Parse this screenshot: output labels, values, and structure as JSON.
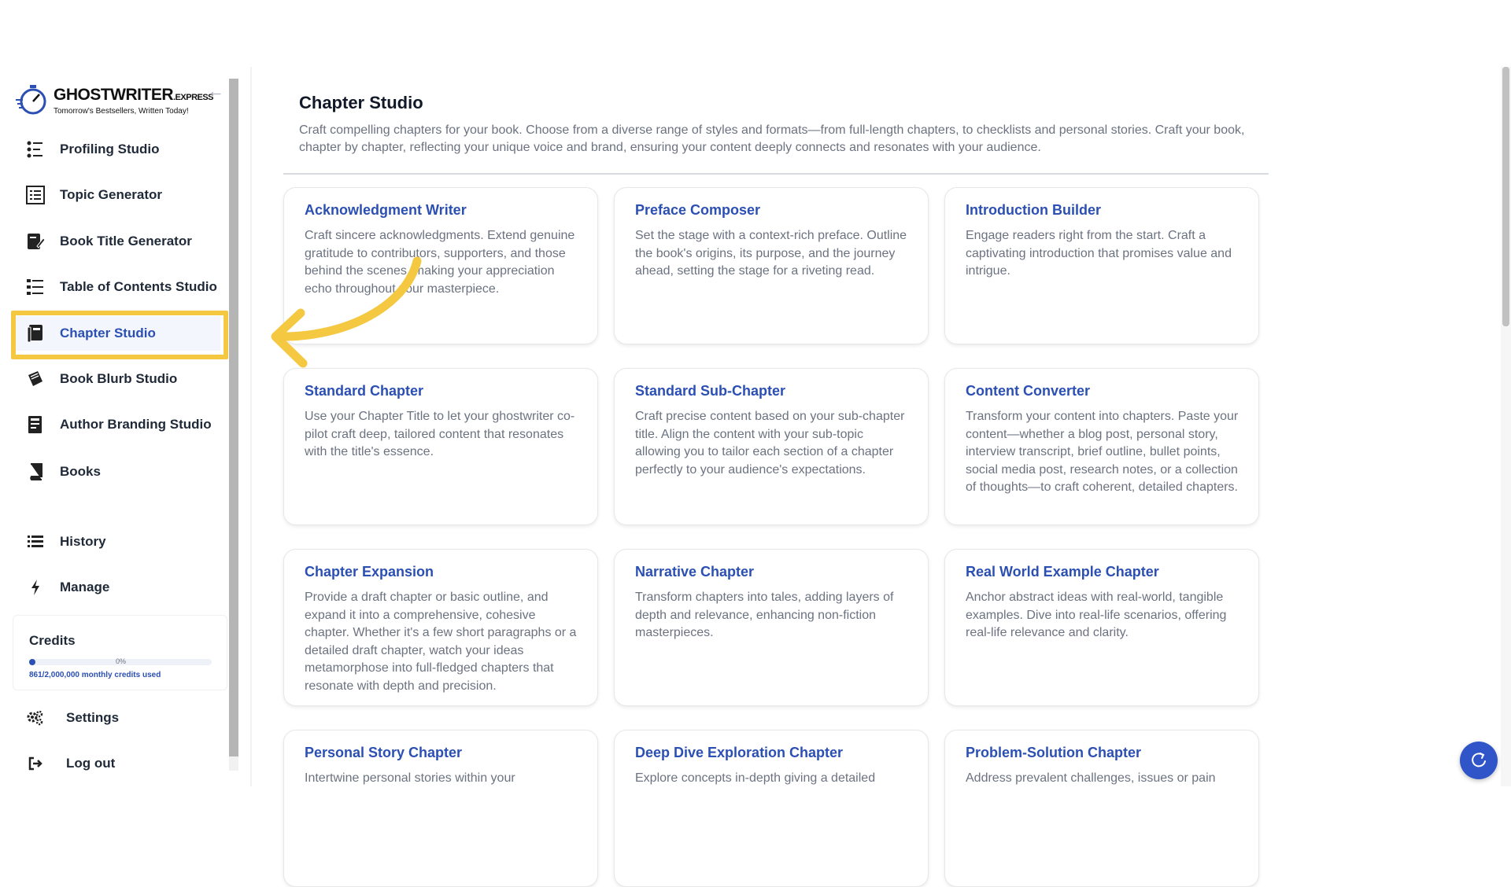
{
  "brand": {
    "name": "GHOSTWRITER",
    "suffix": ".EXPRESS",
    "tagline": "Tomorrow's Bestsellers, Written Today!"
  },
  "sidebar": {
    "items": [
      {
        "label": "Profiling Studio",
        "icon": "profiling-icon"
      },
      {
        "label": "Topic Generator",
        "icon": "topic-icon"
      },
      {
        "label": "Book Title Generator",
        "icon": "book-title-icon"
      },
      {
        "label": "Table of Contents Studio",
        "icon": "toc-icon"
      },
      {
        "label": "Chapter Studio",
        "icon": "chapter-icon",
        "active": true
      },
      {
        "label": "Book Blurb Studio",
        "icon": "blurb-icon"
      },
      {
        "label": "Author Branding Studio",
        "icon": "branding-icon"
      },
      {
        "label": "Books",
        "icon": "books-icon"
      }
    ],
    "secondary": [
      {
        "label": "History",
        "icon": "list-icon"
      },
      {
        "label": "Manage",
        "icon": "bolt-icon"
      }
    ],
    "credits": {
      "title": "Credits",
      "percent_label": "0%",
      "used_label": "861/2,000,000 monthly credits used",
      "fraction": 0.0004
    },
    "footer": [
      {
        "label": "Settings",
        "icon": "gears-icon"
      },
      {
        "label": "Log out",
        "icon": "logout-icon"
      }
    ]
  },
  "page": {
    "title": "Chapter Studio",
    "description": "Craft compelling chapters for your book. Choose from a diverse range of styles and formats—from full-length chapters, to checklists and personal stories. Craft your book, chapter by chapter, reflecting your unique voice and brand, ensuring your content deeply connects and resonates with your audience."
  },
  "cards": [
    {
      "title": "Acknowledgment Writer",
      "desc": "Craft sincere acknowledgments. Extend genuine gratitude to contributors, supporters, and those behind the scenes, making your appreciation echo throughout your masterpiece."
    },
    {
      "title": "Preface Composer",
      "desc": "Set the stage with a context-rich preface. Outline the book's origins, its purpose, and the journey ahead, setting the stage for a riveting read."
    },
    {
      "title": "Introduction Builder",
      "desc": "Engage readers right from the start. Craft a captivating introduction that promises value and intrigue."
    },
    {
      "title": "Standard Chapter",
      "desc": "Use your Chapter Title to let your ghostwriter co-pilot craft deep, tailored content that resonates with the title's essence."
    },
    {
      "title": "Standard Sub-Chapter",
      "desc": "Craft precise content based on your sub-chapter title. Align the content with your sub-topic allowing you to tailor each section of a chapter perfectly to your audience's expectations."
    },
    {
      "title": "Content Converter",
      "desc": "Transform your content into chapters. Paste your content—whether a blog post, personal story, interview transcript, brief outline, bullet points, social media post, research notes, or a collection of thoughts—to craft coherent, detailed chapters."
    },
    {
      "title": "Chapter Expansion",
      "desc": "Provide a draft chapter or basic outline, and expand it into a comprehensive, cohesive chapter. Whether it's a few short paragraphs or a detailed draft chapter, watch your ideas metamorphose into full-fledged chapters that resonate with depth and precision."
    },
    {
      "title": "Narrative Chapter",
      "desc": "Transform chapters into tales, adding layers of depth and relevance, enhancing non-fiction masterpieces."
    },
    {
      "title": "Real World Example Chapter",
      "desc": "Anchor abstract ideas with real-world, tangible examples. Dive into real-life scenarios, offering real-life relevance and clarity."
    },
    {
      "title": "Personal Story Chapter",
      "desc": "Intertwine personal stories within your"
    },
    {
      "title": "Deep Dive Exploration Chapter",
      "desc": "Explore concepts in-depth giving a detailed"
    },
    {
      "title": "Problem-Solution Chapter",
      "desc": "Address prevalent challenges, issues or pain"
    }
  ],
  "colors": {
    "accent": "#2b4fb3",
    "highlight": "#f5c842"
  }
}
